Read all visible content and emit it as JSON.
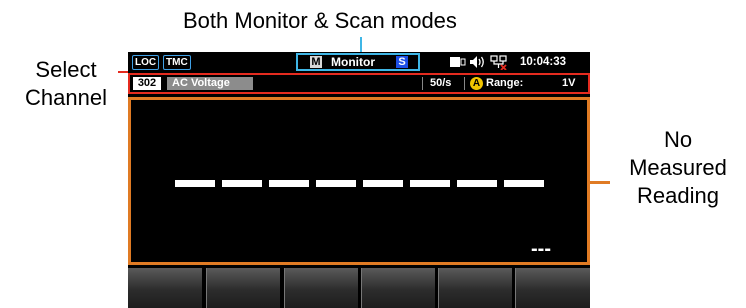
{
  "annotations": {
    "top_caption": "Both Monitor & Scan modes",
    "left_label_line1": "Select",
    "left_label_line2": "Channel",
    "right_label_line1": "No",
    "right_label_line2": "Measured",
    "right_label_line3": "Reading"
  },
  "status_bar": {
    "loc": "LOC",
    "tmc": "TMC",
    "mode_m": "M",
    "mode_label": "Monitor",
    "mode_s": "S",
    "icons": [
      "usb-icon",
      "speaker-icon",
      "lan-icon"
    ],
    "time": "10:04:33"
  },
  "channel_bar": {
    "channel": "302",
    "function": "AC Voltage",
    "rate": "50/s",
    "auto_icon": "A",
    "range_label": "Range:",
    "range_value": "1V"
  },
  "display": {
    "main_reading": "--------",
    "sub_reading": "---"
  },
  "softkeys": [
    "",
    "",
    "",
    "",
    "",
    ""
  ],
  "colors": {
    "highlight_blue": "#3fb6e6",
    "highlight_red": "#e52b1f",
    "highlight_orange": "#e07b24",
    "mode_s_blue": "#1d4fe6",
    "auto_yellow": "#f2c500"
  }
}
